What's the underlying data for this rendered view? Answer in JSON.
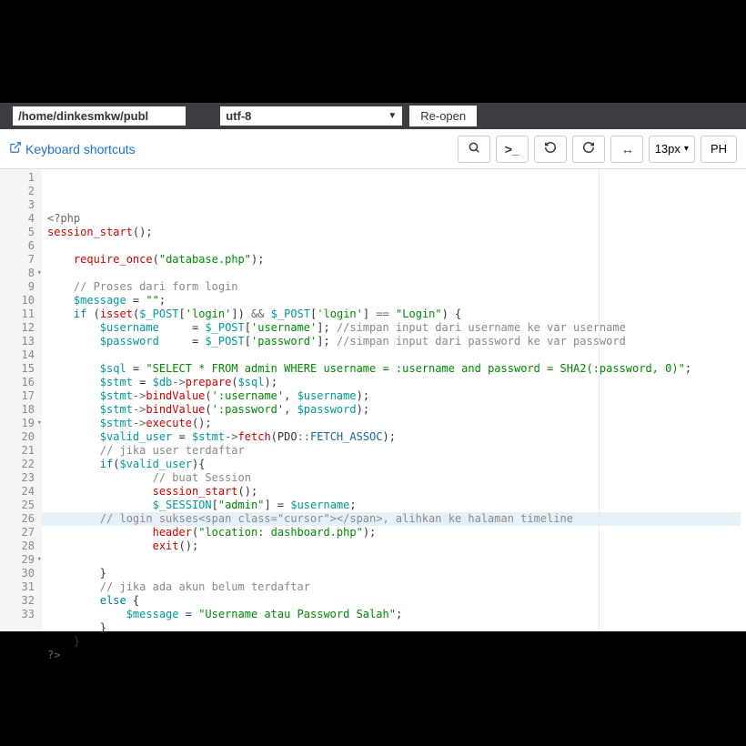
{
  "topbar": {
    "path": "/home/dinkesmkw/publ",
    "encoding": "utf-8",
    "reopen": "Re-open"
  },
  "toolbar": {
    "shortcuts": "Keyboard shortcuts",
    "font_size": "13px",
    "language": "PH"
  },
  "gutter": {
    "lines": [
      "1",
      "2",
      "3",
      "4",
      "5",
      "6",
      "7",
      "8",
      "9",
      "10",
      "11",
      "12",
      "13",
      "14",
      "15",
      "16",
      "17",
      "18",
      "19",
      "20",
      "21",
      "22",
      "23",
      "24",
      "25",
      "26",
      "27",
      "28",
      "29",
      "30",
      "31",
      "32",
      "33"
    ],
    "folds": [
      7,
      18,
      28
    ]
  },
  "code": [
    {
      "t": "open",
      "v": "<?php"
    },
    {
      "t": "fn",
      "v": "session_start",
      "suffix": "();"
    },
    {
      "t": "blank"
    },
    {
      "t": "require",
      "indent": 1,
      "fn": "require_once",
      "str": "\"database.php\""
    },
    {
      "t": "blank"
    },
    {
      "t": "com",
      "indent": 1,
      "v": "// Proses dari form login"
    },
    {
      "t": "assign",
      "indent": 1,
      "var": "$message",
      "val": "\"\""
    },
    {
      "t": "if_login",
      "indent": 1
    },
    {
      "t": "assign_post",
      "indent": 2,
      "var": "$username",
      "pad": "    ",
      "key": "'username'",
      "com": "//simpan input dari username ke var username"
    },
    {
      "t": "assign_post",
      "indent": 2,
      "var": "$password",
      "pad": "    ",
      "key": "'password'",
      "com": "//simpan input dari password ke var password"
    },
    {
      "t": "blank"
    },
    {
      "t": "assign",
      "indent": 2,
      "var": "$sql",
      "val": "\"SELECT * FROM admin WHERE username = :username and password = SHA2(:password, 0)\""
    },
    {
      "t": "stmt_prepare",
      "indent": 2
    },
    {
      "t": "stmt_bind",
      "indent": 2,
      "key": "':username'",
      "var2": "$username"
    },
    {
      "t": "stmt_bind",
      "indent": 2,
      "key": "':password'",
      "var2": "$password"
    },
    {
      "t": "stmt_exec",
      "indent": 2
    },
    {
      "t": "valid_user",
      "indent": 2
    },
    {
      "t": "com",
      "indent": 2,
      "v": "// jika user terdaftar"
    },
    {
      "t": "if_valid",
      "indent": 2
    },
    {
      "t": "com",
      "indent": 4,
      "v": "// buat Session"
    },
    {
      "t": "fn_call",
      "indent": 4,
      "fn": "session_start"
    },
    {
      "t": "session_set",
      "indent": 4
    },
    {
      "t": "com_hl",
      "indent": 2,
      "v": "// login sukses, alihkan ke halaman timeline"
    },
    {
      "t": "header",
      "indent": 4
    },
    {
      "t": "fn_call",
      "indent": 4,
      "fn": "exit"
    },
    {
      "t": "blank"
    },
    {
      "t": "close",
      "indent": 2,
      "v": "}"
    },
    {
      "t": "com",
      "indent": 2,
      "v": "// jika ada akun belum terdaftar"
    },
    {
      "t": "else",
      "indent": 2
    },
    {
      "t": "assign",
      "indent": 3,
      "var": "$message",
      "val": "\"Username atau Password Salah\""
    },
    {
      "t": "close",
      "indent": 2,
      "v": "}"
    },
    {
      "t": "close",
      "indent": 1,
      "v": "}"
    },
    {
      "t": "close_php",
      "v": "?>"
    }
  ]
}
